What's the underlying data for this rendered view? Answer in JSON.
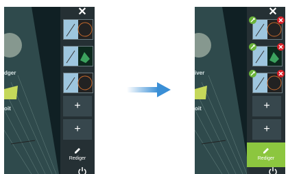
{
  "before": {
    "close_icon": "x-icon",
    "side_labels": [
      "dger",
      "oit"
    ],
    "favorites": [
      {
        "name": "chart-radar-split"
      },
      {
        "name": "chart-sonar-split"
      },
      {
        "name": "chart-radar-split-2"
      }
    ],
    "add_buttons": [
      "+",
      "+"
    ],
    "edit_label": "Rediger",
    "power_icon": "power-icon"
  },
  "after": {
    "close_icon": "x-icon",
    "side_labels": [
      "iver",
      "oit"
    ],
    "favorites": [
      {
        "name": "chart-radar-split",
        "edit_icon": "wrench-icon",
        "remove_icon": "x-icon"
      },
      {
        "name": "chart-sonar-split",
        "edit_icon": "wrench-icon",
        "remove_icon": "x-icon"
      },
      {
        "name": "chart-radar-split-2",
        "edit_icon": "wrench-icon",
        "remove_icon": "x-icon"
      }
    ],
    "add_buttons": [
      "+",
      "+"
    ],
    "edit_label": "Rediger",
    "power_icon": "power-icon"
  },
  "colors": {
    "accent_green": "#8cc63f",
    "remove_red": "#d62027",
    "arrow_blue": "#3a8fd6"
  }
}
